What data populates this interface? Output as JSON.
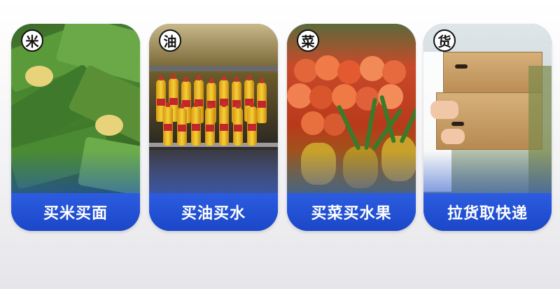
{
  "cards": [
    {
      "badge": "米",
      "label": "买米买面",
      "photo": "rice-sacks-photo"
    },
    {
      "badge": "油",
      "label": "买油买水",
      "photo": "cooking-oil-shelf-photo"
    },
    {
      "badge": "菜",
      "label": "买菜买水果",
      "photo": "fruit-stall-photo"
    },
    {
      "badge": "货",
      "label": "拉货取快递",
      "photo": "carrying-boxes-photo"
    }
  ],
  "colors": {
    "card_blue": "#1f4fd0",
    "label_text": "#ffffff",
    "badge_bg": "#ffffff"
  }
}
